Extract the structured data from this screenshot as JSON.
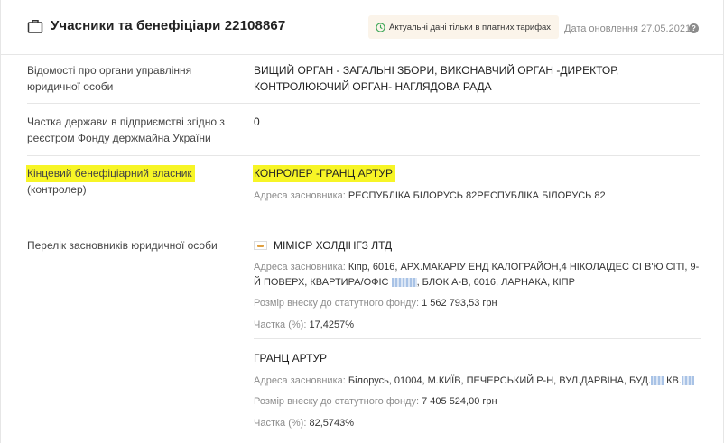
{
  "header": {
    "title": "Учасники та бенефіціари 22108867",
    "badge": "Актуальні дані тільки в платних тарифах",
    "updated": "Дата оновлення 27.05.2021",
    "help": "?"
  },
  "rows": [
    {
      "label": "Відомості про органи управління юридичної особи",
      "value": "ВИЩИЙ ОРГАН - ЗАГАЛЬНІ ЗБОРИ, ВИКОНАВЧИЙ ОРГАН -ДИРЕКТОР, КОНТРОЛЮЮЧИЙ ОРГАН- НАГЛЯДОВА РАДА"
    },
    {
      "label": "Частка держави в підприємстві згідно з реєстром Фонду держмайна України",
      "value": "0"
    },
    {
      "label_main": "Кінцевий бенефіціарний власник",
      "label_sub": "(контролер)",
      "value": "КОНРОЛЕР -ГРАНЦ АРТУР",
      "address_label": "Адреса засновника:",
      "address": "РЕСПУБЛІКА БІЛОРУСЬ 82РЕСПУБЛІКА БІЛОРУСЬ 82"
    },
    {
      "label": "Перелік засновників юридичної особи",
      "founders": [
        {
          "name": "МІМІЄР ХОЛДІНГЗ ЛТД",
          "address_label": "Адреса засновника:",
          "address_part1": "Кіпр, 6016, АРХ.МАКАРІУ ЕНД КАЛОГРАЙОН,4 НІКОЛАІДЕС СІ В'Ю СІТІ, 9-Й ПОВЕРХ, КВАРТИРА/ОФІС",
          "address_part2": ", БЛОК А-В, 6016, ЛАРНАКА, КІПР",
          "capital_label": "Розмір внеску до статутного фонду:",
          "capital": "1 562 793,53 грн",
          "share_label": "Частка (%):",
          "share": "17,4257%"
        },
        {
          "name": "ГРАНЦ АРТУР",
          "address_label": "Адреса засновника:",
          "address_part1": "Білорусь, 01004, М.КИЇВ, ПЕЧЕРСЬКИЙ Р-Н, ВУЛ.ДАРВІНА, БУД.",
          "address_part2": "КВ.",
          "capital_label": "Розмір внеску до статутного фонду:",
          "capital": "7 405 524,00 грн",
          "share_label": "Частка (%):",
          "share": "82,5743%"
        }
      ]
    }
  ],
  "colors": {
    "highlight": "#f7f526",
    "badge_bg": "#fbf4ea",
    "clock_green": "#3aa655",
    "muted": "#8c8c8c"
  }
}
